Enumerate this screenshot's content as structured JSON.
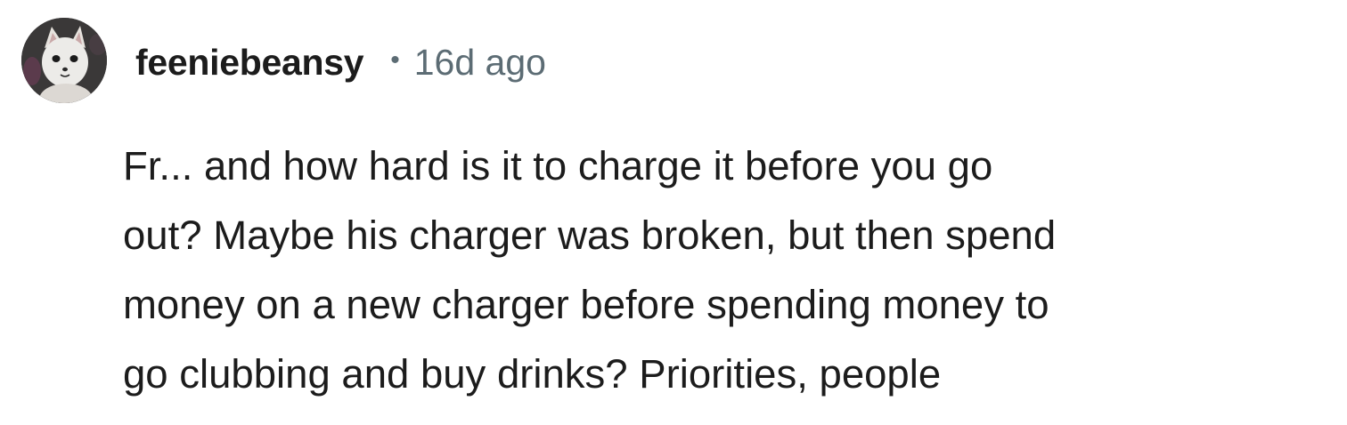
{
  "comment": {
    "username": "feeniebeansy",
    "separator": "•",
    "timestamp": "16d ago",
    "lines": [
      "Fr... and how hard is it to charge it before you go",
      "out? Maybe his charger was broken, but then spend",
      "money on a new charger before spending money to",
      "go clubbing and buy drinks? Priorities, people"
    ]
  },
  "avatar": {
    "icon": "white-cat-avatar-icon",
    "background_color": "#3b3b3b"
  },
  "colors": {
    "username": "#1c1c1c",
    "meta": "#5c6c74",
    "body": "#1c1c1c",
    "background": "#ffffff"
  }
}
